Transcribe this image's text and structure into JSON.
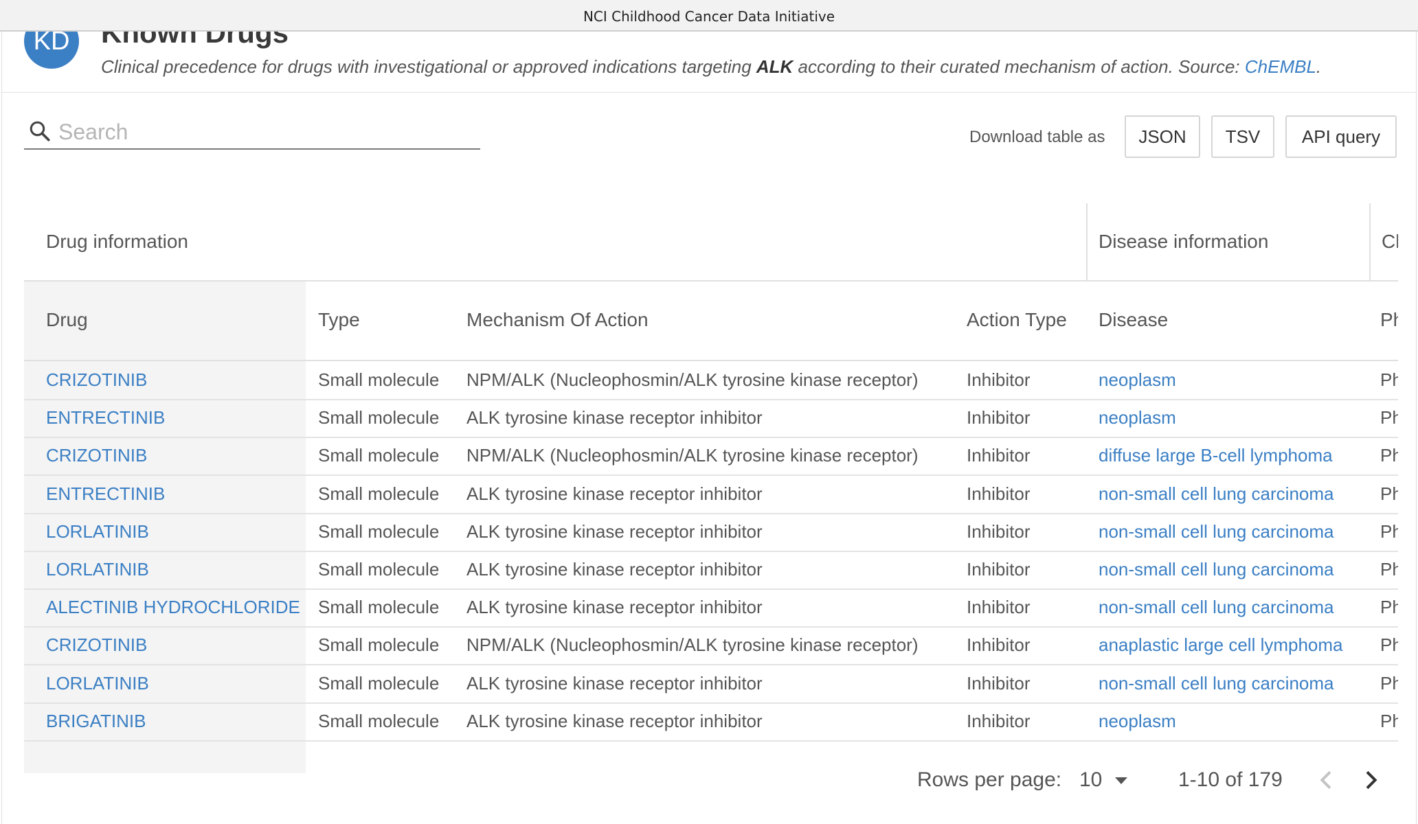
{
  "window": {
    "title": "NCI Childhood Cancer Data Initiative"
  },
  "section": {
    "avatar": "KD",
    "title": "Known Drugs",
    "desc_prefix": "Clinical precedence for drugs with investigational or approved indications targeting ",
    "desc_target": "ALK",
    "desc_middle": " according to their curated mechanism of action. Source: ",
    "desc_source": "ChEMBL",
    "desc_suffix": "."
  },
  "search": {
    "placeholder": "Search",
    "value": ""
  },
  "download": {
    "label": "Download table as",
    "buttons": [
      "JSON",
      "TSV",
      "API query"
    ]
  },
  "table": {
    "groups": [
      "Drug information",
      "Disease information",
      "Cl"
    ],
    "columns": [
      "Drug",
      "Type",
      "Mechanism Of Action",
      "Action Type",
      "Disease",
      "Ph"
    ],
    "rows": [
      {
        "drug": "CRIZOTINIB",
        "type": "Small molecule",
        "moa": "NPM/ALK (Nucleophosmin/ALK tyrosine kinase receptor)",
        "action": "Inhibitor",
        "disease": "neoplasm",
        "phase": "Ph"
      },
      {
        "drug": "ENTRECTINIB",
        "type": "Small molecule",
        "moa": "ALK tyrosine kinase receptor inhibitor",
        "action": "Inhibitor",
        "disease": "neoplasm",
        "phase": "Ph"
      },
      {
        "drug": "CRIZOTINIB",
        "type": "Small molecule",
        "moa": "NPM/ALK (Nucleophosmin/ALK tyrosine kinase receptor)",
        "action": "Inhibitor",
        "disease": "diffuse large B-cell lymphoma",
        "phase": "Ph"
      },
      {
        "drug": "ENTRECTINIB",
        "type": "Small molecule",
        "moa": "ALK tyrosine kinase receptor inhibitor",
        "action": "Inhibitor",
        "disease": "non-small cell lung carcinoma",
        "phase": "Ph"
      },
      {
        "drug": "LORLATINIB",
        "type": "Small molecule",
        "moa": "ALK tyrosine kinase receptor inhibitor",
        "action": "Inhibitor",
        "disease": "non-small cell lung carcinoma",
        "phase": "Ph"
      },
      {
        "drug": "LORLATINIB",
        "type": "Small molecule",
        "moa": "ALK tyrosine kinase receptor inhibitor",
        "action": "Inhibitor",
        "disease": "non-small cell lung carcinoma",
        "phase": "Ph"
      },
      {
        "drug": "ALECTINIB HYDROCHLORIDE",
        "type": "Small molecule",
        "moa": "ALK tyrosine kinase receptor inhibitor",
        "action": "Inhibitor",
        "disease": "non-small cell lung carcinoma",
        "phase": "Ph"
      },
      {
        "drug": "CRIZOTINIB",
        "type": "Small molecule",
        "moa": "NPM/ALK (Nucleophosmin/ALK tyrosine kinase receptor)",
        "action": "Inhibitor",
        "disease": "anaplastic large cell lymphoma",
        "phase": "Ph"
      },
      {
        "drug": "LORLATINIB",
        "type": "Small molecule",
        "moa": "ALK tyrosine kinase receptor inhibitor",
        "action": "Inhibitor",
        "disease": "non-small cell lung carcinoma",
        "phase": "Ph"
      },
      {
        "drug": "BRIGATINIB",
        "type": "Small molecule",
        "moa": "ALK tyrosine kinase receptor inhibitor",
        "action": "Inhibitor",
        "disease": "neoplasm",
        "phase": "Ph"
      }
    ]
  },
  "pagination": {
    "rows_label": "Rows per page:",
    "rows_value": "10",
    "range": "1-10 of 179"
  },
  "colors": {
    "link": "#3b7fc4",
    "avatar": "#3b7fc4"
  }
}
